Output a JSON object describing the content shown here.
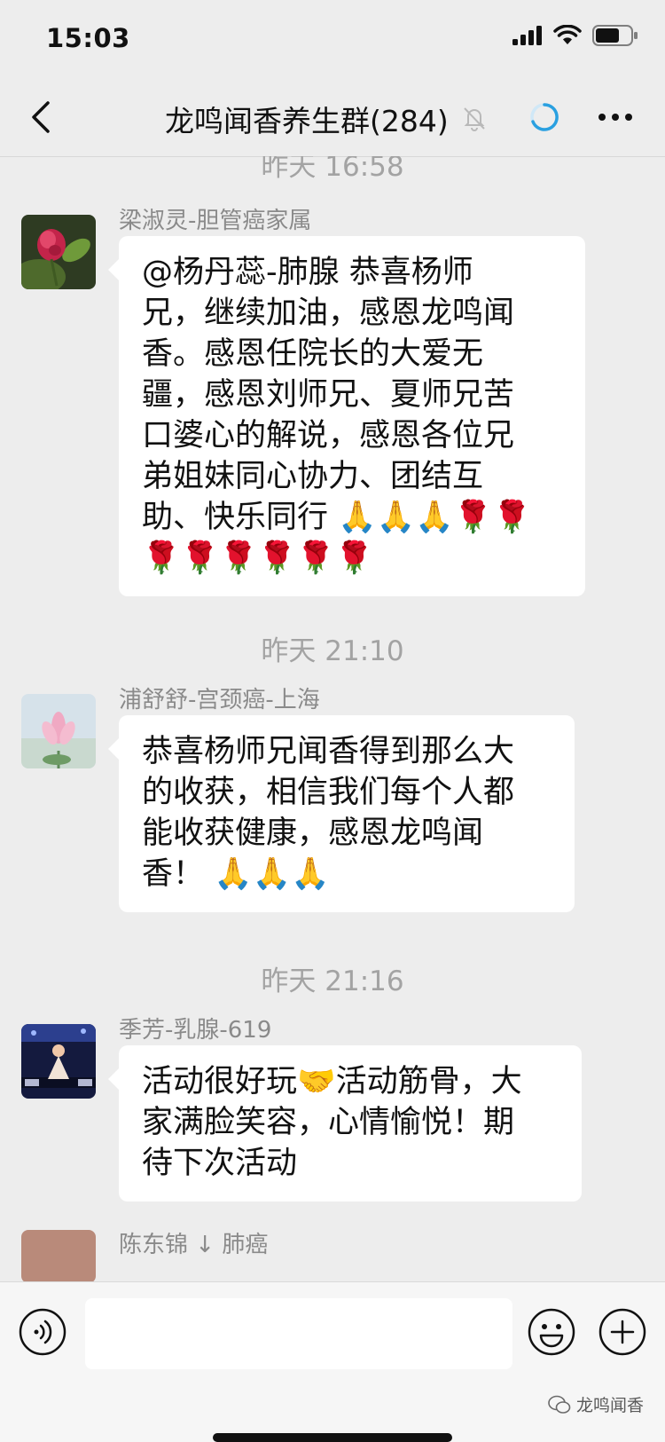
{
  "status": {
    "time": "15:03"
  },
  "header": {
    "title": "龙鸣闻香养生群(284)"
  },
  "messages": [
    {
      "time_top": "昨天 16:58"
    },
    {
      "sender": "梁淑灵-胆管癌家属",
      "text": "@杨丹蕊-肺腺 恭喜杨师\n兄，继续加油，感恩龙鸣闻\n香。感恩任院长的大爱无\n疆，感恩刘师兄、夏师兄苦\n口婆心的解说，感恩各位兄\n弟姐妹同心协力、团结互\n助、快乐同行 🙏🙏🙏🌹🌹\n🌹🌹🌹🌹🌹🌹"
    },
    {
      "time": "昨天 21:10",
      "sender": "浦舒舒-宫颈癌-上海",
      "text": "恭喜杨师兄闻香得到那么大\n的收获，相信我们每个人都\n能收获健康，感恩龙鸣闻\n香！ 🙏🙏🙏"
    },
    {
      "time": "昨天 21:16",
      "sender": "季芳-乳腺-619",
      "text": "活动很好玩🤝活动筋骨，大\n家满脸笑容，心情愉悦！期\n待下次活动"
    },
    {
      "sender_partial": "陈东锦 ↓ 肺癌"
    }
  ],
  "input": {
    "placeholder": ""
  },
  "watermark": {
    "label": "龙鸣闻香"
  }
}
